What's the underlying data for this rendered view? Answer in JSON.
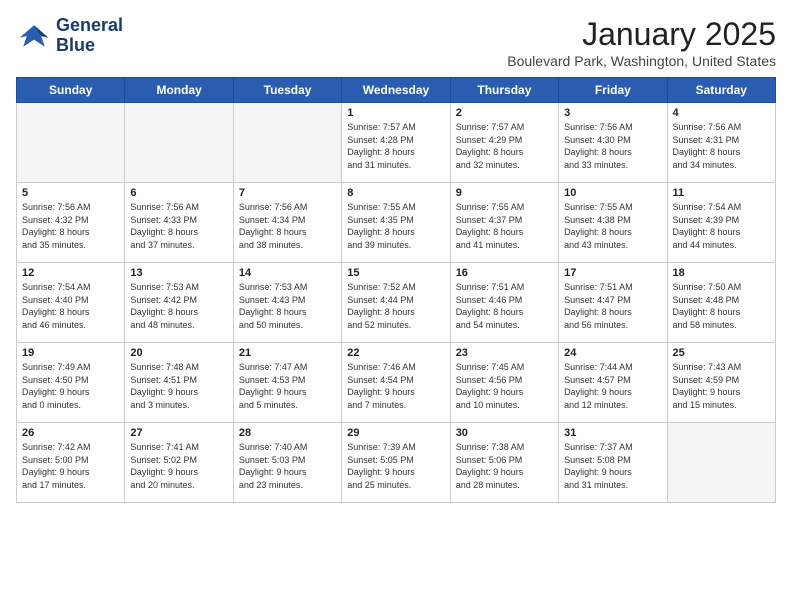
{
  "header": {
    "logo_line1": "General",
    "logo_line2": "Blue",
    "month": "January 2025",
    "location": "Boulevard Park, Washington, United States"
  },
  "weekdays": [
    "Sunday",
    "Monday",
    "Tuesday",
    "Wednesday",
    "Thursday",
    "Friday",
    "Saturday"
  ],
  "weeks": [
    [
      {
        "day": "",
        "info": ""
      },
      {
        "day": "",
        "info": ""
      },
      {
        "day": "",
        "info": ""
      },
      {
        "day": "1",
        "info": "Sunrise: 7:57 AM\nSunset: 4:28 PM\nDaylight: 8 hours\nand 31 minutes."
      },
      {
        "day": "2",
        "info": "Sunrise: 7:57 AM\nSunset: 4:29 PM\nDaylight: 8 hours\nand 32 minutes."
      },
      {
        "day": "3",
        "info": "Sunrise: 7:56 AM\nSunset: 4:30 PM\nDaylight: 8 hours\nand 33 minutes."
      },
      {
        "day": "4",
        "info": "Sunrise: 7:56 AM\nSunset: 4:31 PM\nDaylight: 8 hours\nand 34 minutes."
      }
    ],
    [
      {
        "day": "5",
        "info": "Sunrise: 7:56 AM\nSunset: 4:32 PM\nDaylight: 8 hours\nand 35 minutes."
      },
      {
        "day": "6",
        "info": "Sunrise: 7:56 AM\nSunset: 4:33 PM\nDaylight: 8 hours\nand 37 minutes."
      },
      {
        "day": "7",
        "info": "Sunrise: 7:56 AM\nSunset: 4:34 PM\nDaylight: 8 hours\nand 38 minutes."
      },
      {
        "day": "8",
        "info": "Sunrise: 7:55 AM\nSunset: 4:35 PM\nDaylight: 8 hours\nand 39 minutes."
      },
      {
        "day": "9",
        "info": "Sunrise: 7:55 AM\nSunset: 4:37 PM\nDaylight: 8 hours\nand 41 minutes."
      },
      {
        "day": "10",
        "info": "Sunrise: 7:55 AM\nSunset: 4:38 PM\nDaylight: 8 hours\nand 43 minutes."
      },
      {
        "day": "11",
        "info": "Sunrise: 7:54 AM\nSunset: 4:39 PM\nDaylight: 8 hours\nand 44 minutes."
      }
    ],
    [
      {
        "day": "12",
        "info": "Sunrise: 7:54 AM\nSunset: 4:40 PM\nDaylight: 8 hours\nand 46 minutes."
      },
      {
        "day": "13",
        "info": "Sunrise: 7:53 AM\nSunset: 4:42 PM\nDaylight: 8 hours\nand 48 minutes."
      },
      {
        "day": "14",
        "info": "Sunrise: 7:53 AM\nSunset: 4:43 PM\nDaylight: 8 hours\nand 50 minutes."
      },
      {
        "day": "15",
        "info": "Sunrise: 7:52 AM\nSunset: 4:44 PM\nDaylight: 8 hours\nand 52 minutes."
      },
      {
        "day": "16",
        "info": "Sunrise: 7:51 AM\nSunset: 4:46 PM\nDaylight: 8 hours\nand 54 minutes."
      },
      {
        "day": "17",
        "info": "Sunrise: 7:51 AM\nSunset: 4:47 PM\nDaylight: 8 hours\nand 56 minutes."
      },
      {
        "day": "18",
        "info": "Sunrise: 7:50 AM\nSunset: 4:48 PM\nDaylight: 8 hours\nand 58 minutes."
      }
    ],
    [
      {
        "day": "19",
        "info": "Sunrise: 7:49 AM\nSunset: 4:50 PM\nDaylight: 9 hours\nand 0 minutes."
      },
      {
        "day": "20",
        "info": "Sunrise: 7:48 AM\nSunset: 4:51 PM\nDaylight: 9 hours\nand 3 minutes."
      },
      {
        "day": "21",
        "info": "Sunrise: 7:47 AM\nSunset: 4:53 PM\nDaylight: 9 hours\nand 5 minutes."
      },
      {
        "day": "22",
        "info": "Sunrise: 7:46 AM\nSunset: 4:54 PM\nDaylight: 9 hours\nand 7 minutes."
      },
      {
        "day": "23",
        "info": "Sunrise: 7:45 AM\nSunset: 4:56 PM\nDaylight: 9 hours\nand 10 minutes."
      },
      {
        "day": "24",
        "info": "Sunrise: 7:44 AM\nSunset: 4:57 PM\nDaylight: 9 hours\nand 12 minutes."
      },
      {
        "day": "25",
        "info": "Sunrise: 7:43 AM\nSunset: 4:59 PM\nDaylight: 9 hours\nand 15 minutes."
      }
    ],
    [
      {
        "day": "26",
        "info": "Sunrise: 7:42 AM\nSunset: 5:00 PM\nDaylight: 9 hours\nand 17 minutes."
      },
      {
        "day": "27",
        "info": "Sunrise: 7:41 AM\nSunset: 5:02 PM\nDaylight: 9 hours\nand 20 minutes."
      },
      {
        "day": "28",
        "info": "Sunrise: 7:40 AM\nSunset: 5:03 PM\nDaylight: 9 hours\nand 23 minutes."
      },
      {
        "day": "29",
        "info": "Sunrise: 7:39 AM\nSunset: 5:05 PM\nDaylight: 9 hours\nand 25 minutes."
      },
      {
        "day": "30",
        "info": "Sunrise: 7:38 AM\nSunset: 5:06 PM\nDaylight: 9 hours\nand 28 minutes."
      },
      {
        "day": "31",
        "info": "Sunrise: 7:37 AM\nSunset: 5:08 PM\nDaylight: 9 hours\nand 31 minutes."
      },
      {
        "day": "",
        "info": ""
      }
    ]
  ]
}
